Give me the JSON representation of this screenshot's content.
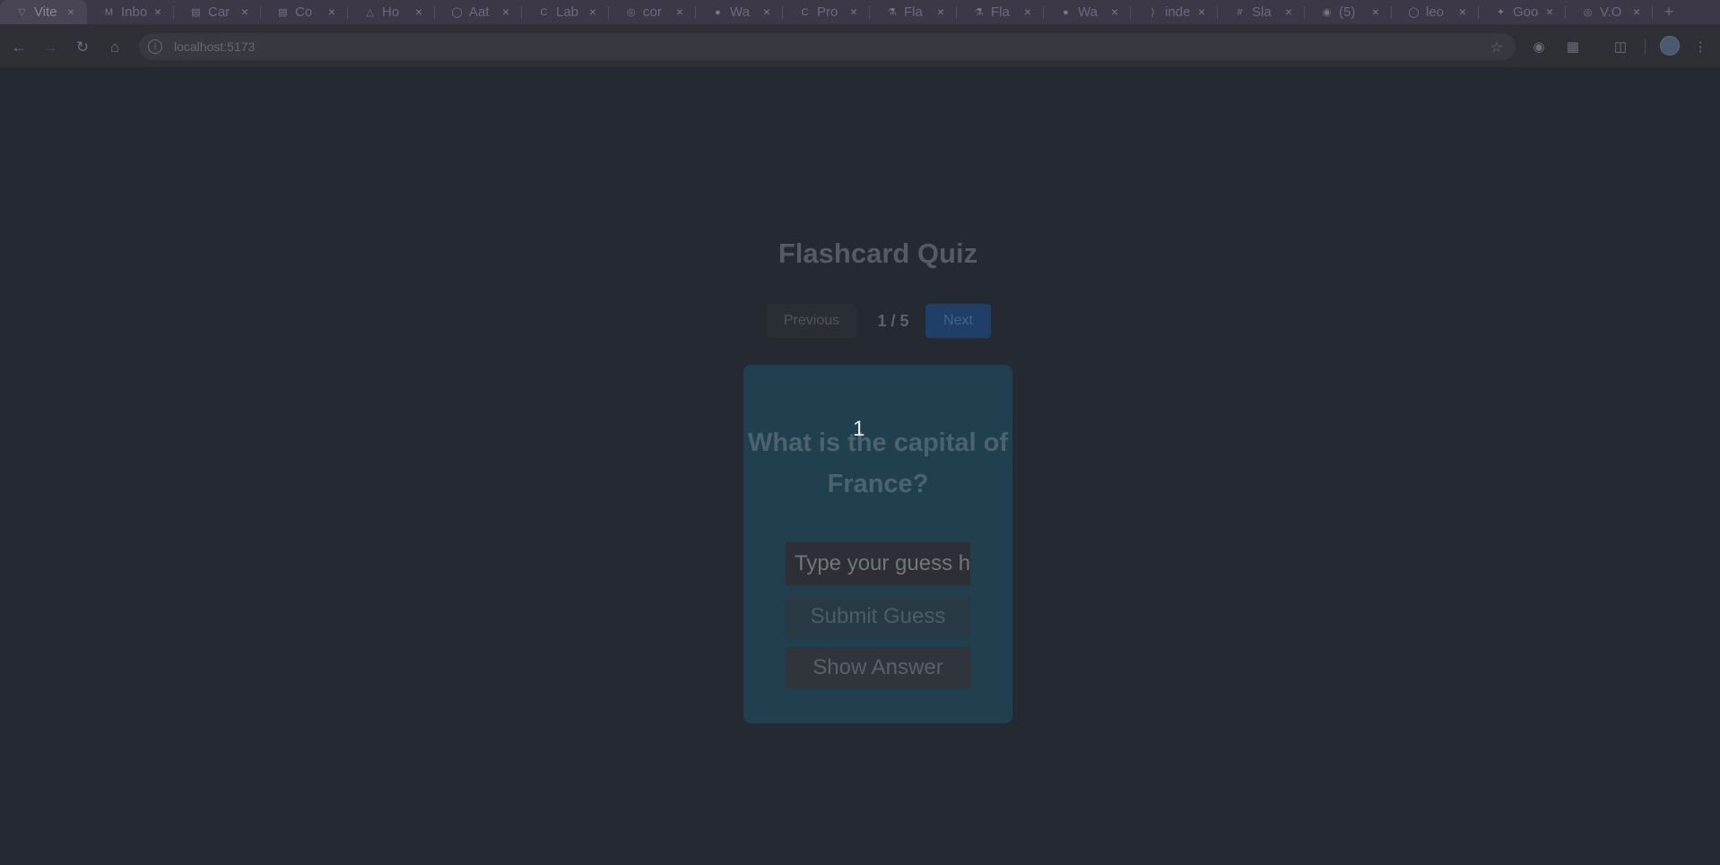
{
  "browser": {
    "tabs": [
      {
        "label": "Vite",
        "icon": "vite-icon"
      },
      {
        "label": "Inbo",
        "icon": "mail-icon"
      },
      {
        "label": "Car",
        "icon": "doc-icon"
      },
      {
        "label": "Co",
        "icon": "doc-icon"
      },
      {
        "label": "Ho",
        "icon": "drive-icon"
      },
      {
        "label": "Aat",
        "icon": "github-icon"
      },
      {
        "label": "Lab",
        "icon": "c-icon"
      },
      {
        "label": "cor",
        "icon": "globe-icon"
      },
      {
        "label": "Wa",
        "icon": "bot-icon"
      },
      {
        "label": "Pro",
        "icon": "c-icon"
      },
      {
        "label": "Fla",
        "icon": "flask-icon"
      },
      {
        "label": "Fla",
        "icon": "flask-icon"
      },
      {
        "label": "Wa",
        "icon": "bot-icon"
      },
      {
        "label": "inde",
        "icon": "vscode-icon"
      },
      {
        "label": "Sla",
        "icon": "slack-icon"
      },
      {
        "label": "(5)",
        "icon": "notification-icon"
      },
      {
        "label": "leo",
        "icon": "github-icon"
      },
      {
        "label": "Goo",
        "icon": "sparkle-icon"
      },
      {
        "label": "V.O",
        "icon": "globe-icon"
      }
    ],
    "new_tab_label": "+",
    "url": "localhost:5173"
  },
  "app": {
    "title": "Flashcard Quiz",
    "previous_label": "Previous",
    "counter": "1 / 5",
    "next_label": "Next",
    "card_number": "1",
    "question": "What is the capital of France?",
    "guess_placeholder": "Type your guess here",
    "submit_label": "Submit Guess",
    "show_answer_label": "Show Answer"
  }
}
